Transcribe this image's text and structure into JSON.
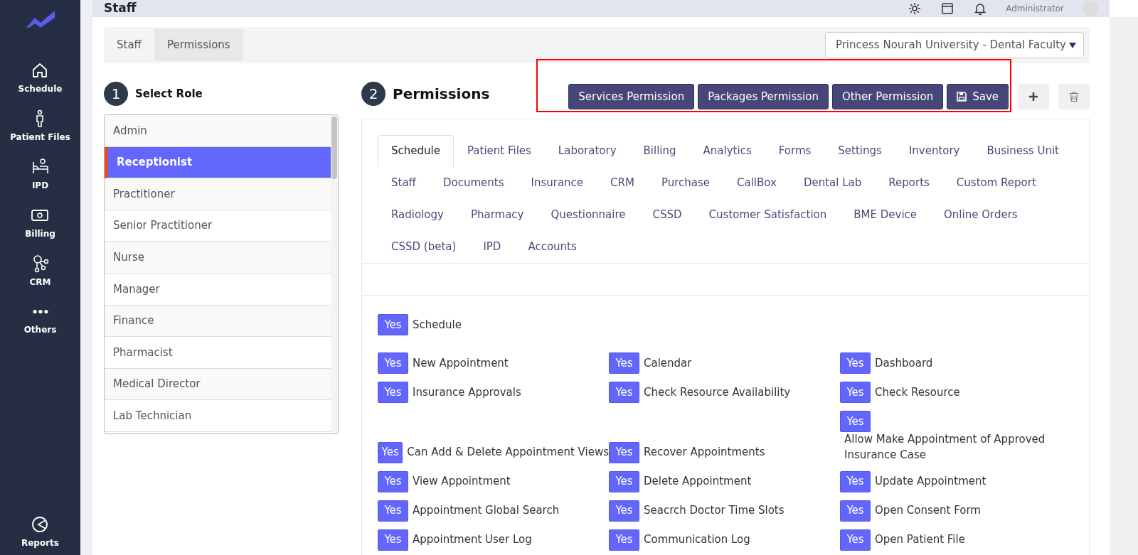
{
  "sidebar": {
    "items": [
      {
        "label": "Schedule"
      },
      {
        "label": "Patient Files"
      },
      {
        "label": "IPD"
      },
      {
        "label": "Billing"
      },
      {
        "label": "CRM"
      },
      {
        "label": "Others"
      }
    ],
    "bottom": {
      "label": "Reports"
    }
  },
  "header": {
    "title": "Staff",
    "user": "Administrator"
  },
  "page_tabs": [
    {
      "label": "Staff",
      "selected": false
    },
    {
      "label": "Permissions",
      "selected": true
    }
  ],
  "branch_select": {
    "value": "Princess Nourah University - Dental Faculty"
  },
  "roles_section": {
    "step": "1",
    "title": "Select Role"
  },
  "roles": [
    {
      "label": "Admin",
      "selected": false
    },
    {
      "label": "Receptionist",
      "selected": true
    },
    {
      "label": "Practitioner",
      "selected": false
    },
    {
      "label": "Senior Practitioner",
      "selected": false
    },
    {
      "label": "Nurse",
      "selected": false
    },
    {
      "label": "Manager",
      "selected": false
    },
    {
      "label": "Finance",
      "selected": false
    },
    {
      "label": "Pharmacist",
      "selected": false
    },
    {
      "label": "Medical Director",
      "selected": false
    },
    {
      "label": "Lab Technician",
      "selected": false
    }
  ],
  "permissions_section": {
    "step": "2",
    "title": "Permissions"
  },
  "action_buttons": [
    {
      "label": "Services Permission",
      "kind": "text"
    },
    {
      "label": "Packages Permission",
      "kind": "text"
    },
    {
      "label": "Other Permission",
      "kind": "text"
    },
    {
      "label": "Save",
      "kind": "save"
    },
    {
      "kind": "add"
    },
    {
      "kind": "delete"
    }
  ],
  "module_tabs": [
    [
      {
        "label": "Schedule",
        "selected": true
      },
      {
        "label": "Patient Files",
        "selected": false
      },
      {
        "label": "Laboratory",
        "selected": false
      },
      {
        "label": "Billing",
        "selected": false
      },
      {
        "label": "Analytics",
        "selected": false
      },
      {
        "label": "Forms",
        "selected": false
      },
      {
        "label": "Settings",
        "selected": false
      },
      {
        "label": "Inventory",
        "selected": false
      },
      {
        "label": "Business Unit",
        "selected": false
      }
    ],
    [
      {
        "label": "Staff",
        "selected": false
      },
      {
        "label": "Documents",
        "selected": false
      },
      {
        "label": "Insurance",
        "selected": false
      },
      {
        "label": "CRM",
        "selected": false
      },
      {
        "label": "Purchase",
        "selected": false
      },
      {
        "label": "CallBox",
        "selected": false
      },
      {
        "label": "Dental Lab",
        "selected": false
      },
      {
        "label": "Reports",
        "selected": false
      },
      {
        "label": "Custom Report",
        "selected": false
      }
    ],
    [
      {
        "label": "Radiology",
        "selected": false
      },
      {
        "label": "Pharmacy",
        "selected": false
      },
      {
        "label": "Questionnaire",
        "selected": false
      },
      {
        "label": "CSSD",
        "selected": false
      },
      {
        "label": "Customer Satisfaction",
        "selected": false
      },
      {
        "label": "BME Device",
        "selected": false
      },
      {
        "label": "Online Orders",
        "selected": false
      }
    ],
    [
      {
        "label": "CSSD (beta)",
        "selected": false
      },
      {
        "label": "IPD",
        "selected": false
      },
      {
        "label": "Accounts",
        "selected": false
      }
    ]
  ],
  "permission_rows": [
    [
      {
        "toggle": "Yes",
        "on": true,
        "label": "Schedule",
        "kind": "inline"
      }
    ],
    [
      {
        "toggle": "Yes",
        "on": true,
        "label": "New Appointment",
        "kind": "inline"
      },
      {
        "toggle": "Yes",
        "on": true,
        "label": "Calendar",
        "kind": "inline"
      },
      {
        "toggle": "Yes",
        "on": true,
        "label": "Dashboard",
        "kind": "inline"
      }
    ],
    [
      {
        "toggle": "Yes",
        "on": true,
        "label": "Insurance Approvals",
        "kind": "inline"
      },
      {
        "toggle": "Yes",
        "on": true,
        "label": "Check Resource Availability",
        "kind": "inline"
      },
      {
        "toggle": "Yes",
        "on": true,
        "label": "Check Resource",
        "kind": "inline"
      }
    ],
    [
      {
        "toggle": "Yes",
        "on": true,
        "label": "Can Add & Delete Appointment Views",
        "kind": "inline"
      },
      {
        "toggle": "Yes",
        "on": true,
        "label": "Recover Appointments",
        "kind": "inline"
      },
      {
        "toggle": "Yes",
        "on": true,
        "label": "Allow Make Appointment of Approved Insurance Case",
        "kind": "stacked"
      }
    ],
    [
      {
        "toggle": "Yes",
        "on": true,
        "label": "View Appointment",
        "kind": "inline"
      },
      {
        "toggle": "Yes",
        "on": true,
        "label": "Delete Appointment",
        "kind": "inline"
      },
      {
        "toggle": "Yes",
        "on": true,
        "label": "Update Appointment",
        "kind": "inline"
      }
    ],
    [
      {
        "toggle": "Yes",
        "on": true,
        "label": "Appointment Global Search",
        "kind": "inline"
      },
      {
        "toggle": "Yes",
        "on": true,
        "label": "Seacrch Doctor Time Slots",
        "kind": "inline"
      },
      {
        "toggle": "Yes",
        "on": true,
        "label": "Open Consent Form",
        "kind": "inline"
      }
    ],
    [
      {
        "toggle": "Yes",
        "on": true,
        "label": "Appointment User Log",
        "kind": "inline"
      },
      {
        "toggle": "Yes",
        "on": true,
        "label": "Communication Log",
        "kind": "inline"
      },
      {
        "toggle": "Yes",
        "on": true,
        "label": "Open Patient File",
        "kind": "inline"
      }
    ]
  ]
}
